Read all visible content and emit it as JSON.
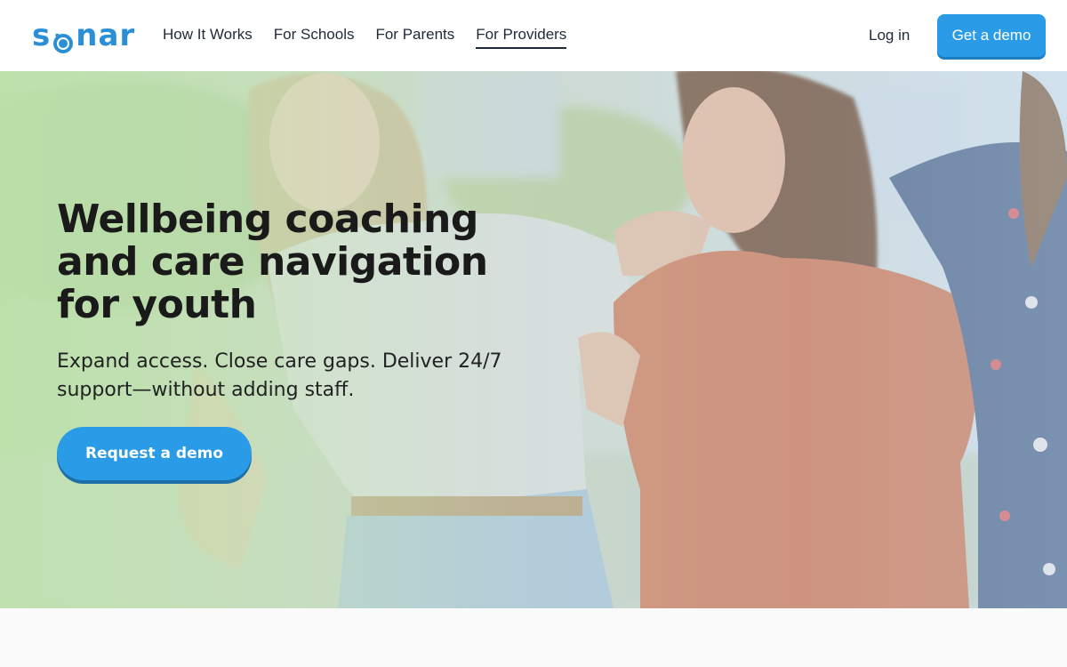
{
  "brand": {
    "name_s": "s",
    "name_rest": "nar",
    "color": "#2a8fd6"
  },
  "nav": {
    "items": [
      {
        "label": "How It Works"
      },
      {
        "label": "For Schools"
      },
      {
        "label": "For Parents"
      },
      {
        "label": "For Providers",
        "active": true
      }
    ]
  },
  "header": {
    "login_label": "Log in",
    "demo_label": "Get a demo"
  },
  "hero": {
    "title": "Wellbeing coaching and care navigation for youth",
    "subtitle": "Expand access. Close care gaps. Deliver 24/7 support—without adding staff.",
    "cta_label": "Request a demo"
  },
  "colors": {
    "accent": "#2a9be6",
    "text": "#1a1a1a"
  }
}
